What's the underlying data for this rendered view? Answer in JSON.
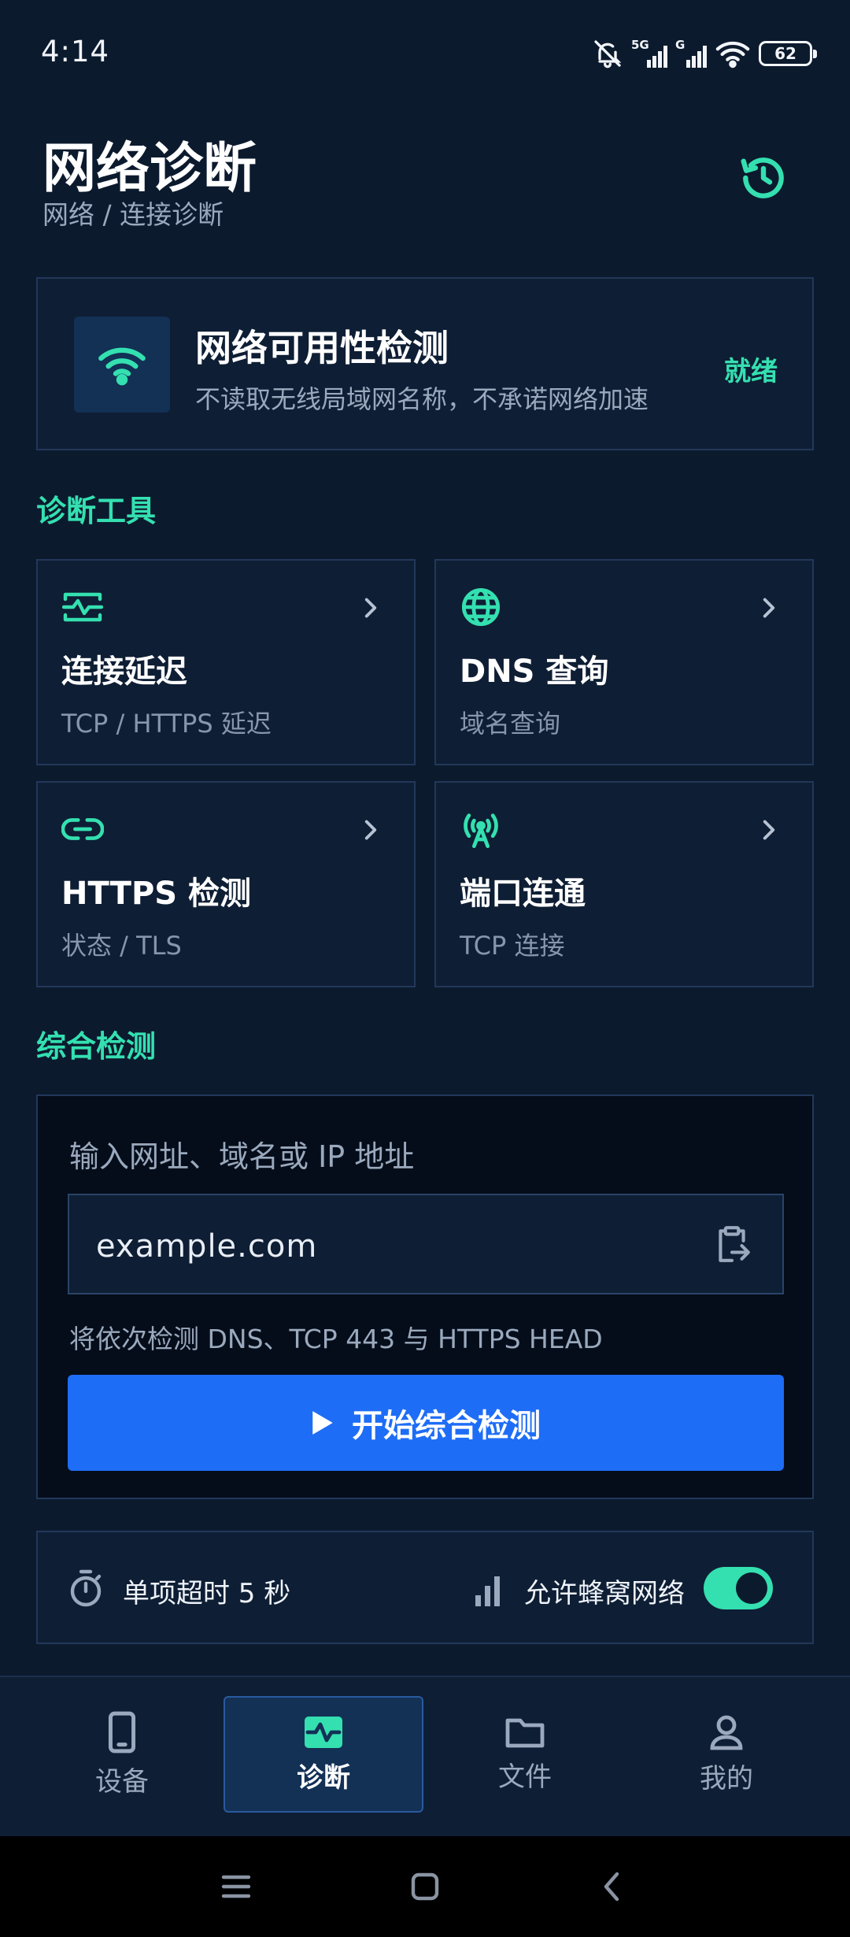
{
  "status_bar": {
    "time": "4:14",
    "battery": "62",
    "network_5g": "5G",
    "network_g": "G"
  },
  "header": {
    "title": "网络诊断",
    "breadcrumb": "网络 / 连接诊断"
  },
  "availability": {
    "title": "网络可用性检测",
    "subtitle": "不读取无线局域网名称，不承诺网络加速",
    "status": "就绪"
  },
  "tools_section": {
    "label": "诊断工具",
    "tools": [
      {
        "title": "连接延迟",
        "subtitle": "TCP / HTTPS 延迟",
        "icon": "pulse-icon"
      },
      {
        "title": "DNS 查询",
        "subtitle": "域名查询",
        "icon": "globe-icon"
      },
      {
        "title": "HTTPS 检测",
        "subtitle": "状态 / TLS",
        "icon": "link-icon"
      },
      {
        "title": "端口连通",
        "subtitle": "TCP 连接",
        "icon": "antenna-icon"
      }
    ]
  },
  "comprehensive": {
    "label": "综合检测",
    "input_label": "输入网址、域名或 IP 地址",
    "input_value": "example.com",
    "hint": "将依次检测 DNS、TCP 443 与 HTTPS HEAD",
    "start_button": "开始综合检测"
  },
  "options": {
    "timeout": "单项超时 5 秒",
    "cellular": "允许蜂窝网络",
    "cellular_enabled": true
  },
  "bottom_nav": {
    "items": [
      {
        "label": "设备",
        "icon": "phone-icon",
        "active": false
      },
      {
        "label": "诊断",
        "icon": "diagnostics-icon",
        "active": true
      },
      {
        "label": "文件",
        "icon": "folder-icon",
        "active": false
      },
      {
        "label": "我的",
        "icon": "person-icon",
        "active": false
      }
    ]
  },
  "colors": {
    "background": "#0c1a2e",
    "accent": "#34e0b0",
    "primary_button": "#1e6df6",
    "card_border": "#22385a"
  }
}
